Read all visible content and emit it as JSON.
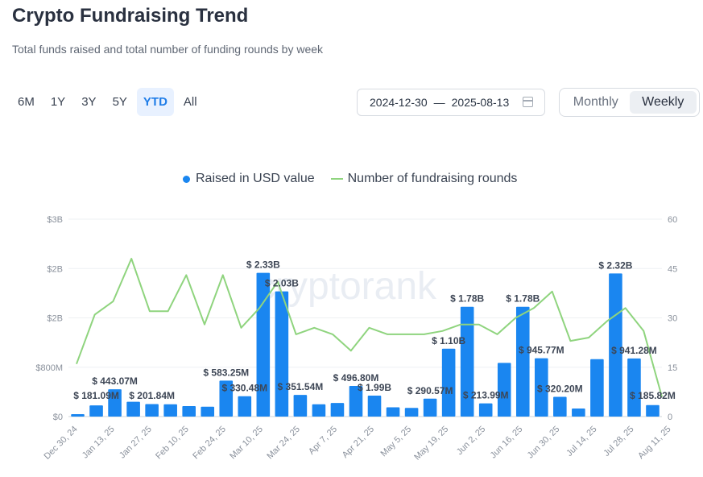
{
  "header": {
    "title": "Crypto Fundraising Trend",
    "subtitle": "Total funds raised and total number of funding rounds by week"
  },
  "ranges": [
    "6M",
    "1Y",
    "3Y",
    "5Y",
    "YTD",
    "All"
  ],
  "active_range": "YTD",
  "date_range": {
    "start": "2024-12-30",
    "separator": "—",
    "end": "2025-08-13"
  },
  "toggle": {
    "monthly": "Monthly",
    "weekly": "Weekly",
    "active": "Weekly"
  },
  "watermark": "cryptorank",
  "colors": {
    "bars": "#1a86f0",
    "line": "#8fd47e",
    "accent": "#1f7de8"
  },
  "chart_data": {
    "type": "bar",
    "title": "Crypto Fundraising Trend",
    "subtitle": "Total funds raised and total number of funding rounds by week",
    "legend": [
      "Raised in USD value",
      "Number of fundraising rounds"
    ],
    "legend_position": "top-center",
    "x_tick_labels": [
      "Dec 30, 24",
      "Jan 13, 25",
      "Jan 27, 25",
      "Feb 10, 25",
      "Feb 24, 25",
      "Mar 10, 25",
      "Mar 24, 25",
      "Apr 7, 25",
      "Apr 21, 25",
      "May 5, 25",
      "May 19, 25",
      "Jun 2, 25",
      "Jun 16, 25",
      "Jun 30, 25",
      "Jul 14, 25",
      "Jul 28, 25",
      "Aug 11, 25"
    ],
    "left_axis": {
      "ticks": [
        "$0",
        "$800M",
        "$2B",
        "$2B",
        "$3B"
      ],
      "ylim": [
        0,
        3200000000
      ]
    },
    "right_axis": {
      "ticks": [
        "0",
        "15",
        "30",
        "45",
        "60"
      ],
      "ylim": [
        0,
        60
      ]
    },
    "grid": true,
    "series": [
      {
        "name": "Raised in USD value",
        "type": "bar",
        "axis": "left",
        "values": [
          40000000,
          181090000,
          443070000,
          240000000,
          201840000,
          200000000,
          170000000,
          160000000,
          583250000,
          330480000,
          2330000000,
          2030000000,
          351540000,
          200000000,
          220000000,
          496800000,
          340000000,
          150000000,
          140000000,
          290570000,
          1100000000,
          1780000000,
          213990000,
          870000000,
          1780000000,
          945770000,
          320200000,
          130000000,
          930000000,
          2320000000,
          941280000,
          185820000
        ]
      },
      {
        "name": "Number of fundraising rounds",
        "type": "line",
        "axis": "right",
        "values": [
          16,
          31,
          35,
          48,
          32,
          32,
          43,
          28,
          43,
          27,
          33,
          41,
          25,
          27,
          25,
          20,
          27,
          25,
          25,
          25,
          26,
          28,
          28,
          25,
          30,
          33,
          38,
          23,
          24,
          29,
          33,
          26,
          6
        ]
      }
    ],
    "data_labels": [
      {
        "index": 1,
        "text": "$ 181.09M"
      },
      {
        "index": 2,
        "text": "$ 443.07M"
      },
      {
        "index": 4,
        "text": "$ 201.84M"
      },
      {
        "index": 8,
        "text": "$ 583.25M"
      },
      {
        "index": 9,
        "text": "$ 330.48M"
      },
      {
        "index": 10,
        "text": "$ 2.33B"
      },
      {
        "index": 11,
        "text": "$ 2.03B"
      },
      {
        "index": 12,
        "text": "$ 351.54M"
      },
      {
        "index": 15,
        "text": "$ 496.80M"
      },
      {
        "index": 16,
        "text": "$ 1.99B"
      },
      {
        "index": 19,
        "text": "$ 290.57M"
      },
      {
        "index": 20,
        "text": "$ 1.10B"
      },
      {
        "index": 21,
        "text": "$ 1.78B"
      },
      {
        "index": 22,
        "text": "$ 213.99M"
      },
      {
        "index": 24,
        "text": "$ 1.78B"
      },
      {
        "index": 25,
        "text": "$ 945.77M"
      },
      {
        "index": 26,
        "text": "$ 320.20M"
      },
      {
        "index": 29,
        "text": "$ 2.32B"
      },
      {
        "index": 30,
        "text": "$ 941.28M"
      },
      {
        "index": 31,
        "text": "$ 185.82M"
      }
    ]
  }
}
